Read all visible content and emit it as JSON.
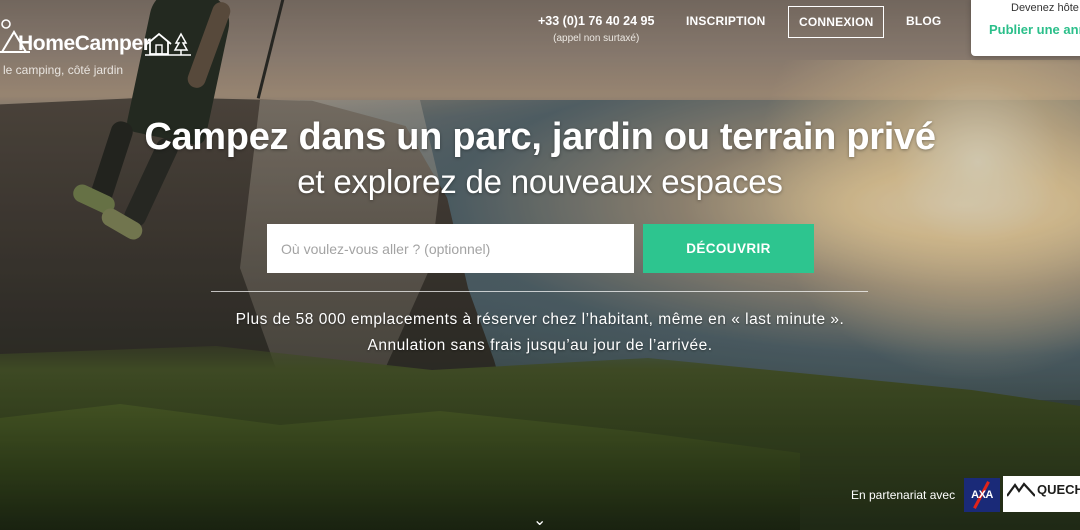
{
  "header": {
    "logo_text": "HomeCamper",
    "tagline": "le camping, côté jardin",
    "phone_number": "+33 (0)1 76 40 24 95",
    "phone_note": "(appel non surtaxé)",
    "nav": {
      "inscription": "INSCRIPTION",
      "connexion": "CONNEXION",
      "blog": "BLOG"
    },
    "host_card": {
      "top_text": "Devenez hôte",
      "cta": "Publier une annonce"
    }
  },
  "hero": {
    "title": "Campez dans un parc, jardin ou terrain privé",
    "subtitle": "et explorez de nouveaux espaces",
    "search": {
      "placeholder": "Où voulez-vous aller ? (optionnel)",
      "value": ""
    },
    "discover_label": "DÉCOUVRIR",
    "info_line1": "Plus de 58 000 emplacements à réserver chez l’habitant, même en « last minute ».",
    "info_line2": "Annulation sans frais jusqu’au jour de l’arrivée."
  },
  "partners": {
    "label": "En partenariat avec",
    "axa": "AXA",
    "quechua": "QUECHUA"
  },
  "icons": {
    "logo": "tent-icon",
    "house": "house-tree-icon",
    "scroll": "chevron-down-icon"
  },
  "colors": {
    "accent": "#2dc58f",
    "host_cta": "#2bbf8a",
    "axa_blue": "#1a2a78",
    "axa_red": "#e2231a"
  }
}
